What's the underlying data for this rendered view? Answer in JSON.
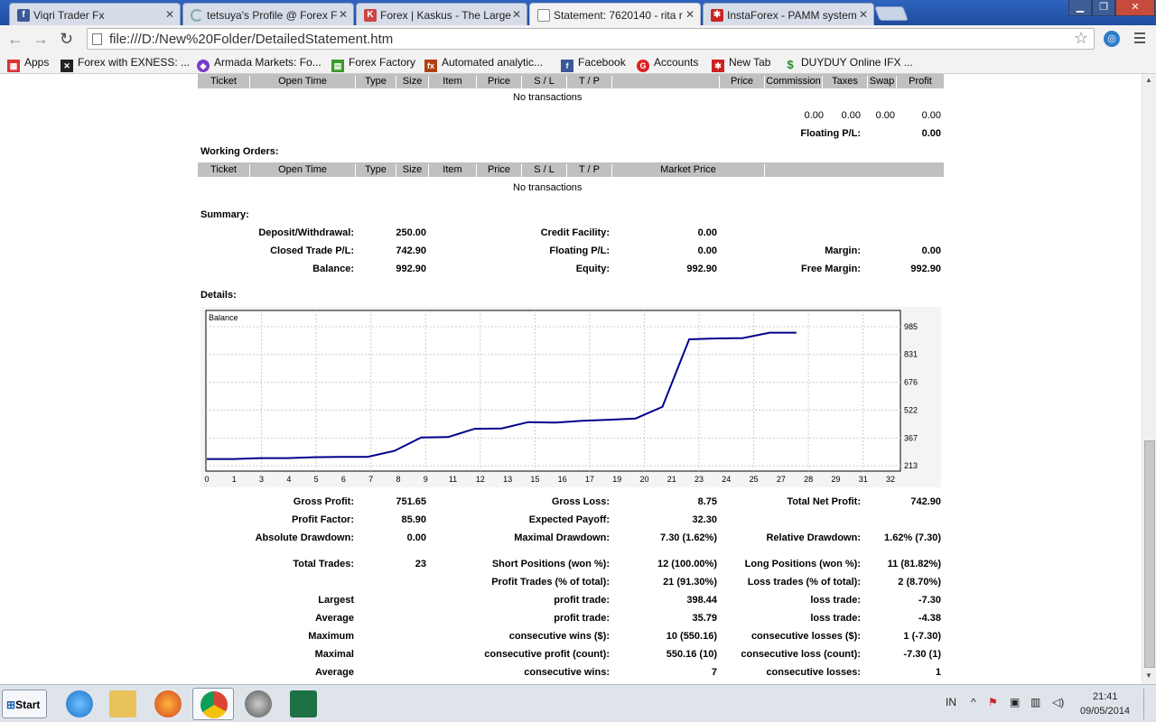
{
  "browser": {
    "tabs": [
      {
        "title": "Viqri Trader Fx",
        "icon": "facebook-icon",
        "color": "#3b5998"
      },
      {
        "title": "tetsuya's Profile @ Forex F",
        "icon": "loading-icon",
        "color": "#8aa"
      },
      {
        "title": "Forex | Kaskus - The Large",
        "icon": "kaskus-icon",
        "color": "#c44"
      },
      {
        "title": "Statement: 7620140 - rita r",
        "icon": "page-icon",
        "color": "#999"
      },
      {
        "title": "InstaForex - PAMM system",
        "icon": "instaforex-icon",
        "color": "#cc2222"
      }
    ],
    "url": "file:///D:/New%20Folder/DetailedStatement.htm",
    "bookmarks": [
      {
        "label": "Apps",
        "icon": "apps-grid-icon",
        "color": "#d33"
      },
      {
        "label": "Forex with EXNESS: ...",
        "icon": "exness-icon",
        "color": "#222"
      },
      {
        "label": "Armada Markets: Fo...",
        "icon": "armada-icon",
        "color": "#7a3cc8"
      },
      {
        "label": "Forex Factory",
        "icon": "forexfactory-icon",
        "color": "#3a9a2a"
      },
      {
        "label": "Automated analytic...",
        "icon": "fx-icon",
        "color": "#b04010"
      },
      {
        "label": "Facebook",
        "icon": "facebook-icon",
        "color": "#3b5998"
      },
      {
        "label": "Accounts",
        "icon": "accounts-icon",
        "color": "#d22"
      },
      {
        "label": "New Tab",
        "icon": "newtab-icon",
        "color": "#c22"
      },
      {
        "label": "DUYDUY Online IFX ...",
        "icon": "dollar-icon",
        "color": "#2a8a2a"
      }
    ]
  },
  "open_trades": {
    "headers": [
      "Ticket",
      "Open Time",
      "Type",
      "Size",
      "Item",
      "Price",
      "S / L",
      "T / P",
      "",
      "Price",
      "Commission",
      "Taxes",
      "Swap",
      "Profit"
    ],
    "empty": "No transactions",
    "totals": [
      "0.00",
      "0.00",
      "0.00",
      "0.00"
    ],
    "floating_label": "Floating P/L:",
    "floating_value": "0.00"
  },
  "working_orders": {
    "title": "Working Orders:",
    "headers": [
      "Ticket",
      "Open Time",
      "Type",
      "Size",
      "Item",
      "Price",
      "S / L",
      "T / P",
      "Market Price",
      ""
    ],
    "empty": "No transactions"
  },
  "summary": {
    "title": "Summary:",
    "deposit_label": "Deposit/Withdrawal:",
    "deposit": "250.00",
    "credit_label": "Credit Facility:",
    "credit": "0.00",
    "closed_label": "Closed Trade P/L:",
    "closed": "742.90",
    "floating_label": "Floating P/L:",
    "floating": "0.00",
    "margin_label": "Margin:",
    "margin": "0.00",
    "balance_label": "Balance:",
    "balance": "992.90",
    "equity_label": "Equity:",
    "equity": "992.90",
    "free_margin_label": "Free Margin:",
    "free_margin": "992.90"
  },
  "details_title": "Details:",
  "chart_data": {
    "type": "line",
    "title": "Balance",
    "x_ticks": [
      "0",
      "1",
      "3",
      "4",
      "5",
      "6",
      "7",
      "8",
      "9",
      "11",
      "12",
      "13",
      "15",
      "16",
      "17",
      "19",
      "20",
      "21",
      "23",
      "24",
      "25",
      "27",
      "28",
      "29",
      "31",
      "32"
    ],
    "y_ticks": [
      "985",
      "831",
      "676",
      "522",
      "367",
      "213"
    ],
    "ylim": [
      213,
      985
    ],
    "series": [
      {
        "values": [
          250,
          250,
          255,
          255,
          260,
          262,
          262,
          295,
          370,
          372,
          418,
          420,
          455,
          452,
          462,
          468,
          475,
          540,
          915,
          920,
          922,
          952,
          952
        ]
      }
    ],
    "line_color": "#00008b",
    "grid": true
  },
  "stats": {
    "gross_profit_label": "Gross Profit:",
    "gross_profit": "751.65",
    "gross_loss_label": "Gross Loss:",
    "gross_loss": "8.75",
    "total_net_label": "Total Net Profit:",
    "total_net": "742.90",
    "profit_factor_label": "Profit Factor:",
    "profit_factor": "85.90",
    "expected_payoff_label": "Expected Payoff:",
    "expected_payoff": "32.30",
    "abs_dd_label": "Absolute Drawdown:",
    "abs_dd": "0.00",
    "max_dd_label": "Maximal Drawdown:",
    "max_dd": "7.30 (1.62%)",
    "rel_dd_label": "Relative Drawdown:",
    "rel_dd": "1.62% (7.30)",
    "total_trades_label": "Total Trades:",
    "total_trades": "23",
    "short_label": "Short Positions (won %):",
    "short": "12 (100.00%)",
    "long_label": "Long Positions (won %):",
    "long": "11 (81.82%)",
    "profit_trades_label": "Profit Trades (% of total):",
    "profit_trades": "21 (91.30%)",
    "loss_trades_label": "Loss trades (% of total):",
    "loss_trades": "2 (8.70%)",
    "largest_label": "Largest",
    "largest_profit_label": "profit trade:",
    "largest_profit": "398.44",
    "largest_loss_label": "loss trade:",
    "largest_loss": "-7.30",
    "average_label": "Average",
    "avg_profit_label": "profit trade:",
    "avg_profit": "35.79",
    "avg_loss_label": "loss trade:",
    "avg_loss": "-4.38",
    "maximum_label": "Maximum",
    "max_cons_wins_label": "consecutive wins ($):",
    "max_cons_wins": "10 (550.16)",
    "max_cons_losses_label": "consecutive losses ($):",
    "max_cons_losses": "1 (-7.30)",
    "maximal_label": "Maximal",
    "maximal_profit_label": "consecutive profit (count):",
    "maximal_profit": "550.16 (10)",
    "maximal_loss_label": "consecutive loss (count):",
    "maximal_loss": "-7.30 (1)",
    "average2_label": "Average",
    "avg_cons_wins_label": "consecutive wins:",
    "avg_cons_wins": "7",
    "avg_cons_losses_label": "consecutive losses:",
    "avg_cons_losses": "1"
  },
  "taskbar": {
    "start": "Start",
    "lang": "IN",
    "time": "21:41",
    "date": "09/05/2014"
  }
}
